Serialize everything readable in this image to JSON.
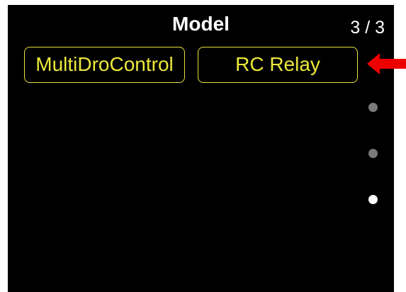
{
  "header": {
    "title": "Model",
    "page_indicator": "3 / 3"
  },
  "models": [
    {
      "label": "MultiDroControl"
    },
    {
      "label": "RC Relay"
    }
  ],
  "pager": {
    "total": 3,
    "current": 3
  },
  "icons": {
    "pointer": "red-arrow-icon"
  },
  "colors": {
    "screen_background": "#000000",
    "title_text": "#ffffff",
    "button_text": "#ece83a",
    "button_border": "#e8e040",
    "inactive_dot": "#7a7a7a",
    "active_dot": "#ffffff",
    "arrow": "#ee0000"
  }
}
